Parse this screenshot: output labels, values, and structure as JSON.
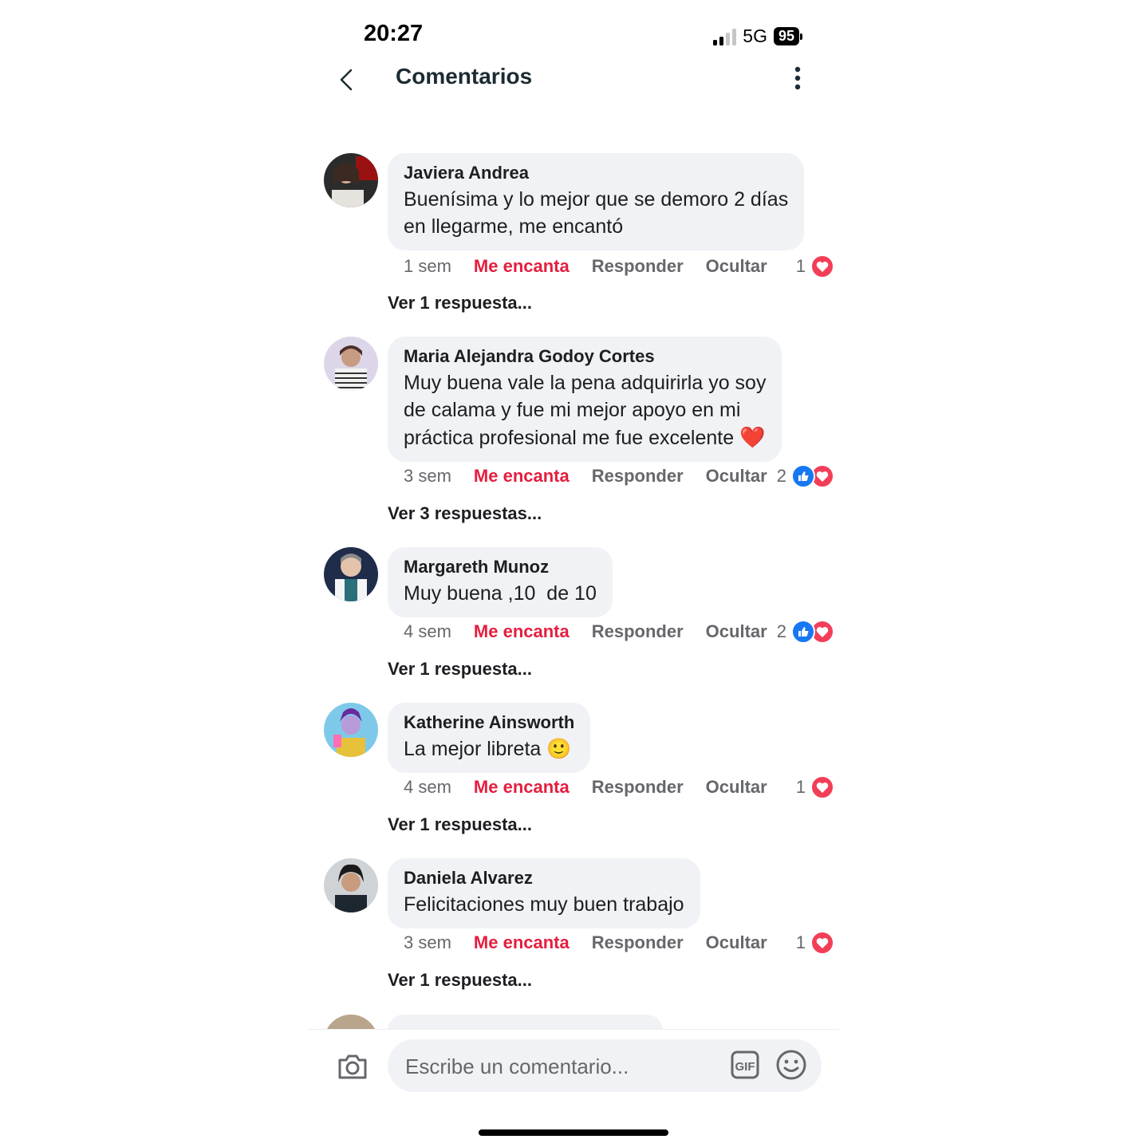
{
  "status_bar": {
    "time": "20:27",
    "network": "5G",
    "battery": "95"
  },
  "header": {
    "title": "Comentarios",
    "back_icon": "chevron-left-icon",
    "more_icon": "more-vertical-icon"
  },
  "comments": [
    {
      "author": "Javiera Andrea",
      "text_lines": [
        "Buenísima y lo mejor que se demoro 2 días",
        "en llegarme, me encantó"
      ],
      "age": "1 sem",
      "love_label": "Me encanta",
      "reply_label": "Responder",
      "hide_label": "Ocultar",
      "reaction_count": "1",
      "reactions": [
        "love"
      ],
      "view_replies": "Ver 1 respuesta..."
    },
    {
      "author": "Maria Alejandra Godoy Cortes",
      "text_lines": [
        "Muy buena vale la pena adquirirla yo soy",
        "de calama y fue mi mejor apoyo en mi",
        "práctica profesional me fue excelente"
      ],
      "trailing_emoji": "❤️",
      "age": "3 sem",
      "love_label": "Me encanta",
      "reply_label": "Responder",
      "hide_label": "Ocultar",
      "reaction_count": "2",
      "reactions": [
        "like",
        "love"
      ],
      "view_replies": "Ver 3 respuestas..."
    },
    {
      "author": "Margareth Munoz",
      "text_lines": [
        "Muy buena ,10  de 10"
      ],
      "age": "4 sem",
      "love_label": "Me encanta",
      "reply_label": "Responder",
      "hide_label": "Ocultar",
      "reaction_count": "2",
      "reactions": [
        "like",
        "love"
      ],
      "view_replies": "Ver 1 respuesta..."
    },
    {
      "author": "Katherine Ainsworth",
      "text_lines": [
        "La mejor libreta"
      ],
      "trailing_emoji": "🙂",
      "age": "4 sem",
      "love_label": "Me encanta",
      "reply_label": "Responder",
      "hide_label": "Ocultar",
      "reaction_count": "1",
      "reactions": [
        "love"
      ],
      "view_replies": "Ver 1 respuesta..."
    },
    {
      "author": "Daniela Alvarez",
      "text_lines": [
        "Felicitaciones muy buen trabajo"
      ],
      "age": "3 sem",
      "love_label": "Me encanta",
      "reply_label": "Responder",
      "hide_label": "Ocultar",
      "reaction_count": "1",
      "reactions": [
        "love"
      ],
      "view_replies": "Ver 1 respuesta..."
    }
  ],
  "composer": {
    "placeholder": "Escribe un comentario...",
    "camera_icon": "camera-icon",
    "gif_icon": "gif-icon",
    "emoji_icon": "emoji-icon"
  },
  "colors": {
    "love": "#e41e3f",
    "like": "#1877f2",
    "bubble": "#f0f2f5",
    "muted": "#65676b"
  }
}
